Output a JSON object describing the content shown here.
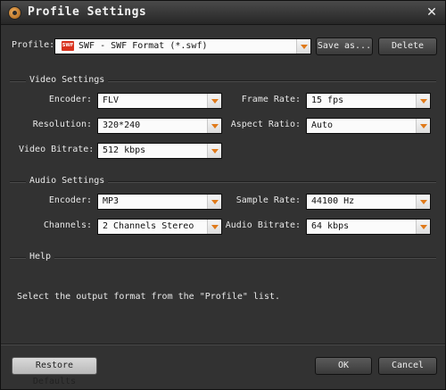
{
  "window": {
    "title": "Profile Settings",
    "close_glyph": "✕"
  },
  "profile": {
    "label": "Profile:",
    "value": "SWF - SWF Format (*.swf)",
    "icon_text": "SWF",
    "save_as_label": "Save as...",
    "delete_label": "Delete"
  },
  "video": {
    "title": "Video Settings",
    "encoder_label": "Encoder:",
    "encoder_value": "FLV",
    "frame_rate_label": "Frame Rate:",
    "frame_rate_value": "15 fps",
    "resolution_label": "Resolution:",
    "resolution_value": "320*240",
    "aspect_ratio_label": "Aspect Ratio:",
    "aspect_ratio_value": "Auto",
    "bitrate_label": "Video Bitrate:",
    "bitrate_value": "512 kbps"
  },
  "audio": {
    "title": "Audio Settings",
    "encoder_label": "Encoder:",
    "encoder_value": "MP3",
    "sample_rate_label": "Sample Rate:",
    "sample_rate_value": "44100 Hz",
    "channels_label": "Channels:",
    "channels_value": "2 Channels Stereo",
    "bitrate_label": "Audio Bitrate:",
    "bitrate_value": "64 kbps"
  },
  "help": {
    "title": "Help",
    "text": "Select the output format from the \"Profile\" list."
  },
  "footer": {
    "restore_label": "Restore Defaults",
    "ok_label": "OK",
    "cancel_label": "Cancel"
  }
}
